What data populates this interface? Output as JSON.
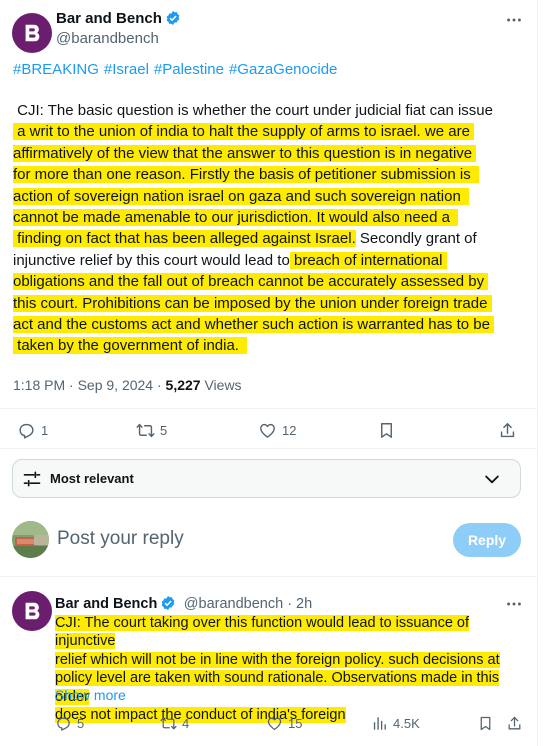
{
  "tweet": {
    "author_name": "Bar and Bench",
    "author_handle": "@barandbench",
    "hashtags": [
      "#BREAKING",
      "#Israel",
      "#Palestine",
      "#GazaGenocide"
    ],
    "body_lines": [
      {
        "plain": " CJI: The basic question is whether the court under judicial fiat can issue",
        "hl": ""
      },
      {
        "plain": "",
        "hl": " a writ to the union of india to halt the supply of arms to israel. we are "
      },
      {
        "plain": "",
        "hl": "affirmatively of the view that the answer to this question is in negative "
      },
      {
        "plain": "",
        "hl": "for more than one reason. Firstly the basis of petitioner submission is  "
      },
      {
        "plain": "",
        "hl": "action of sovereign nation israel on gaza and such sovereign nation  "
      },
      {
        "plain": "",
        "hl": "cannot be made amenable to our jurisdiction. It would also need a  "
      },
      {
        "plain": "",
        "hl": " finding on fact that has been alleged against Israel.",
        "tail": " Secondly grant of"
      },
      {
        "plain": "injunctive relief by this court would lead to",
        "hl": " breach of international "
      },
      {
        "plain": "",
        "hl": "obligations and the fall out of breach cannot be accurately assessed by "
      },
      {
        "plain": "",
        "hl": "this court. Prohibitions can be imposed by the union under foreign trade "
      },
      {
        "plain": "",
        "hl": "act and the customs act and whether such action is warranted has to be "
      },
      {
        "plain": "",
        "hl": " taken by the government of india.  "
      }
    ],
    "time": "1:18 PM · Sep 9, 2024 · ",
    "views_count": "5,227",
    "views_label": " Views",
    "replies": "1",
    "reposts": "5",
    "likes": "12"
  },
  "sort": {
    "label": "Most relevant"
  },
  "compose": {
    "placeholder": "Post your reply",
    "button": "Reply"
  },
  "reply_tweet": {
    "author_name": "Bar and Bench",
    "author_handle": "@barandbench · 2h",
    "body_lines": [
      "CJI: The court taking over this function would lead to issuance of injunctive",
      "relief which will not be in line with the foreign policy. such decisions at",
      "policy level are taken with sound rationale. Observations made in this order",
      "does not impact the conduct of india's foreign"
    ],
    "show_more": "Show more",
    "replies": "5",
    "reposts": "4",
    "likes": "15",
    "views": "4.5K"
  },
  "icons": {
    "brand_color": "#6b1e6e",
    "verified_color": "#1d9bf0",
    "highlight_color": "#ffeb00",
    "action_icons": [
      "reply-icon",
      "repost-icon",
      "like-icon",
      "bookmark-icon",
      "share-icon",
      "views-icon"
    ]
  }
}
